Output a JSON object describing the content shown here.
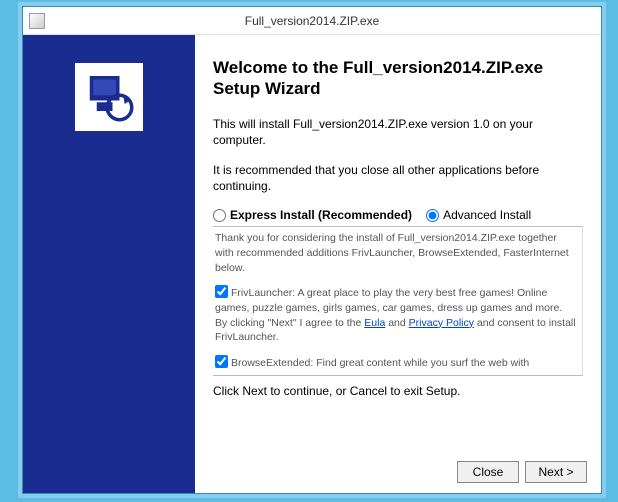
{
  "window": {
    "title": "Full_version2014.ZIP.exe"
  },
  "wizard": {
    "heading": "Welcome to the Full_version2014.ZIP.exe Setup Wizard",
    "intro": "This will install Full_version2014.ZIP.exe version 1.0 on your computer.",
    "recommend": "It is recommended that you close all other applications before continuing.",
    "radio_express": "Express Install (Recommended)",
    "radio_advanced": "Advanced Install",
    "thanks": "Thank you for considering the install of Full_version2014.ZIP.exe together with recommended additions FrivLauncher, BrowseExtended, FasterInternet below.",
    "friv_label": "FrivLauncher:",
    "friv_text": " A great place to play the very best free games! Online games, puzzle games, girls games, car games, dress up games and more. By clicking \"Next\" I agree to the ",
    "eula": "Eula",
    "and": " and ",
    "privacy": "Privacy Policy",
    "friv_tail": " and consent to install FrivLauncher.",
    "browse_label": "BrowseExtended:",
    "browse_text": " Find great content while you surf the web with",
    "footer": "Click Next to continue, or Cancel to exit Setup."
  },
  "buttons": {
    "close": "Close",
    "next": "Next >"
  }
}
